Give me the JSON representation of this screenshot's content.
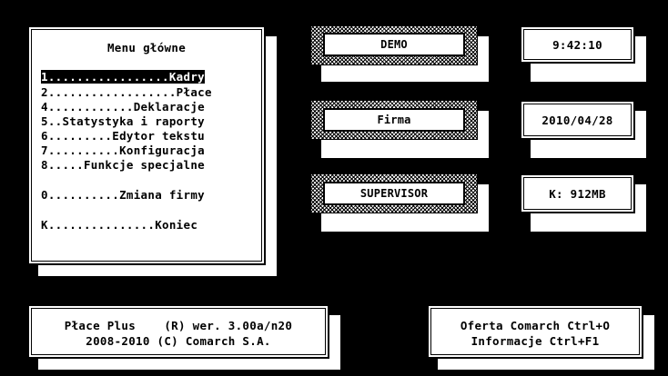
{
  "menu": {
    "title": "Menu główne",
    "items": [
      {
        "key": "1",
        "text": "1.................Kadry",
        "selected": true
      },
      {
        "key": "2",
        "text": "2..................Płace",
        "selected": false
      },
      {
        "key": "4",
        "text": "4............Deklaracje",
        "selected": false
      },
      {
        "key": "5",
        "text": "5..Statystyka i raporty",
        "selected": false
      },
      {
        "key": "6",
        "text": "6.........Edytor tekstu",
        "selected": false
      },
      {
        "key": "7",
        "text": "7..........Konfiguracja",
        "selected": false
      },
      {
        "key": "8",
        "text": "8.....Funkcje specjalne",
        "selected": false
      },
      {
        "key": "0",
        "text": "0..........Zmiana firmy",
        "selected": false
      },
      {
        "key": "K",
        "text": "K...............Koniec",
        "selected": false
      }
    ]
  },
  "info": {
    "database": "DEMO",
    "company": "Firma",
    "operator": "SUPERVISOR",
    "time": "9:42:10",
    "date": "2010/04/28",
    "disk": "K: 912MB"
  },
  "footer": {
    "product_line1": "Płace Plus    (R) wer. 3.00a/n20",
    "product_line2": "2008-2010 (C) Comarch S.A.",
    "offer_line": "Oferta Comarch Ctrl+O",
    "info_line": "Informacje Ctrl+F1"
  }
}
